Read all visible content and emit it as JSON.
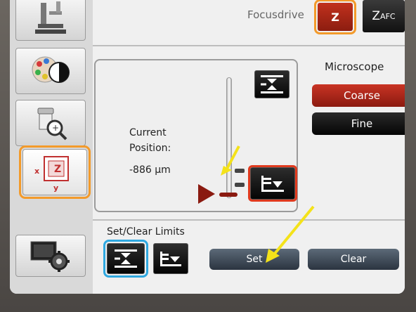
{
  "header": {
    "focusdrive_label": "Focusdrive",
    "z_button_label": "Z",
    "zafc_button_main": "Z",
    "zafc_button_sub": "AFC"
  },
  "sidebar": {
    "items": [
      {
        "icon": "microscope-icon"
      },
      {
        "icon": "color-contrast-icon"
      },
      {
        "icon": "magnifier-icon"
      },
      {
        "icon": "xyz-stage-icon",
        "labels": {
          "x": "x",
          "y": "y",
          "z": "Z"
        }
      },
      {
        "icon": "settings-gear-icon"
      }
    ]
  },
  "position": {
    "label_line1": "Current",
    "label_line2": "Position:",
    "value": "-886 µm"
  },
  "microscope": {
    "title": "Microscope",
    "coarse_label": "Coarse",
    "fine_label": "Fine"
  },
  "limits": {
    "title": "Set/Clear Limits",
    "set_label": "Set",
    "clear_label": "Clear"
  },
  "colors": {
    "accent_red": "#c1311d",
    "highlight_orange": "#f39a2a",
    "highlight_blue": "#2fa8e0",
    "annotation_yellow": "#f4e21a"
  }
}
